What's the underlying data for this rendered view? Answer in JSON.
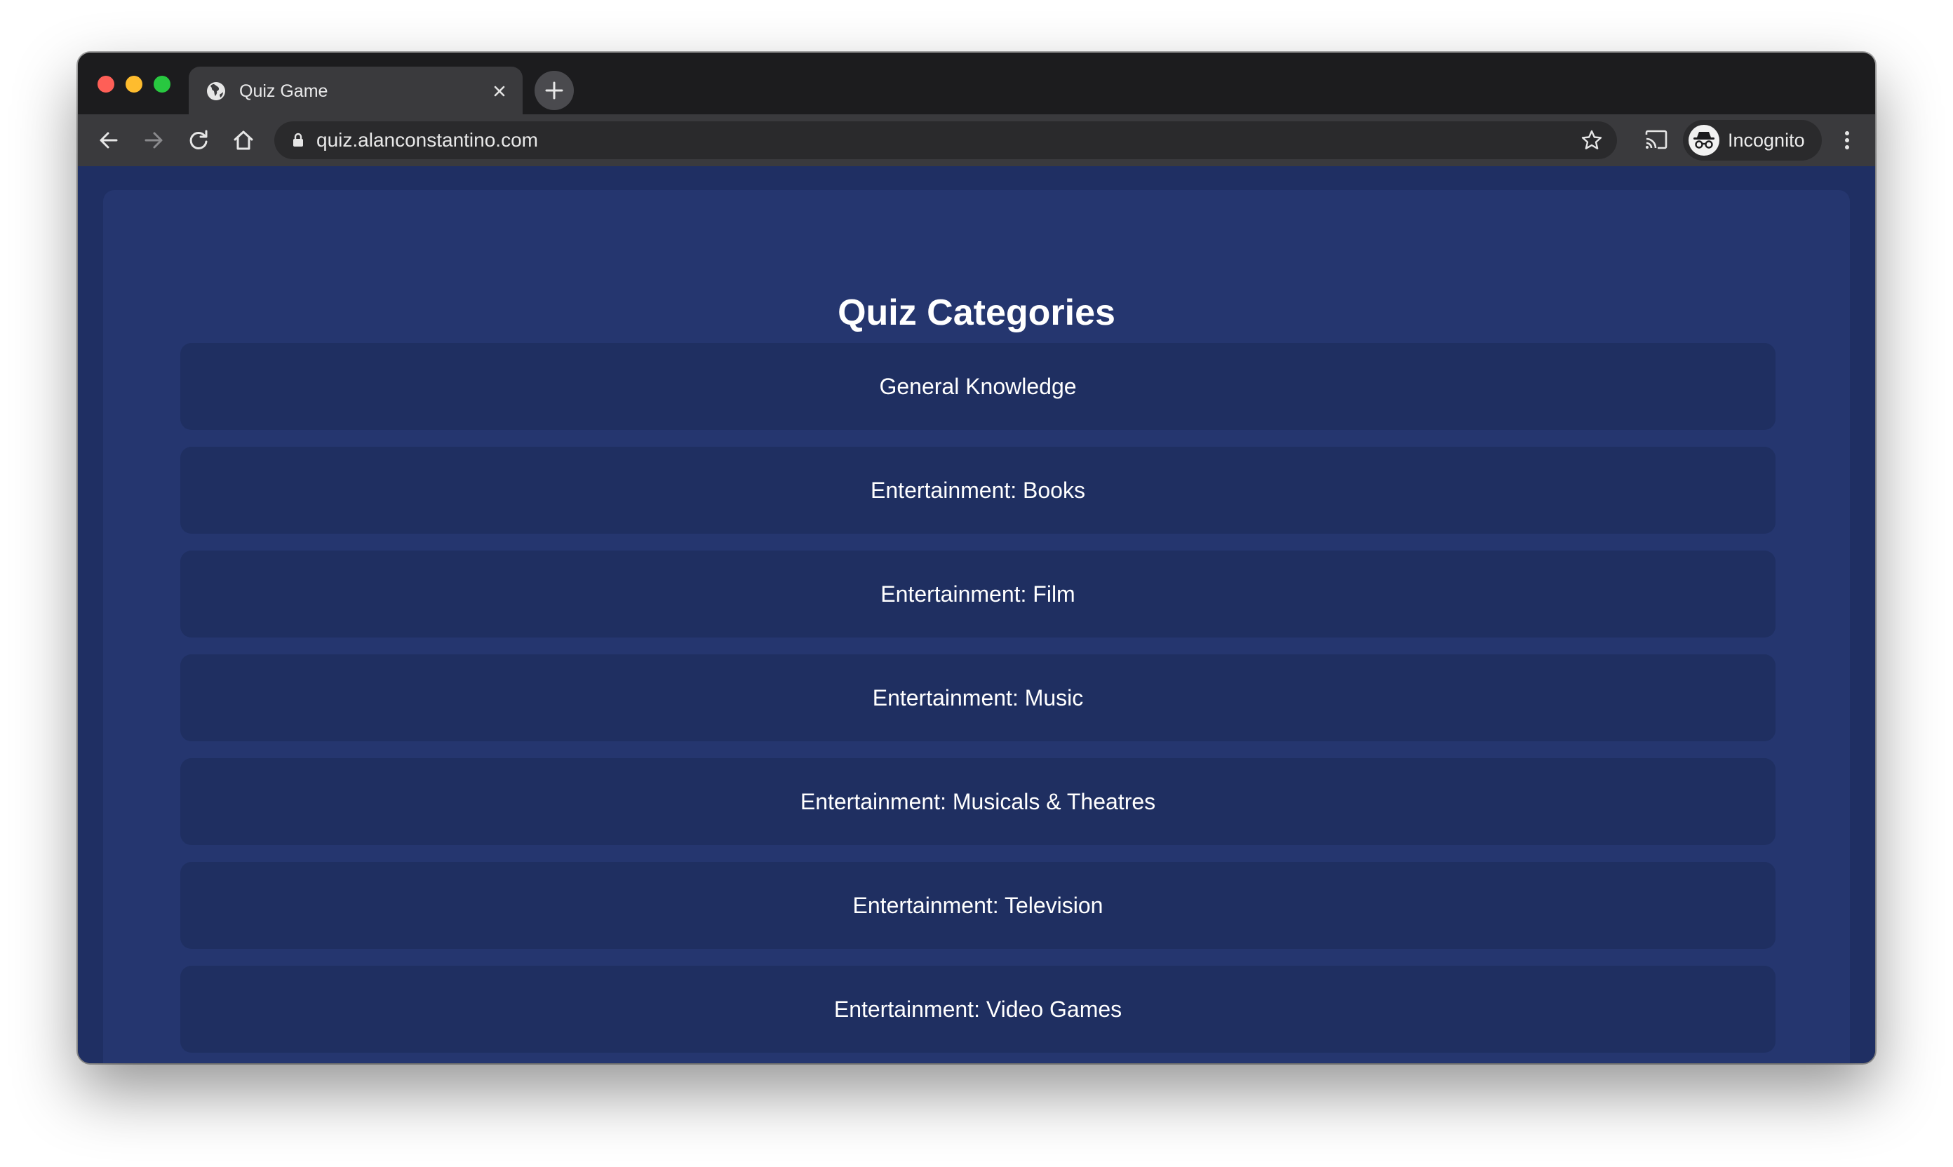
{
  "browser": {
    "tab": {
      "title": "Quiz Game"
    },
    "omnibox": {
      "url": "quiz.alanconstantino.com"
    },
    "profile": {
      "label": "Incognito"
    }
  },
  "main": {
    "title": "Quiz Categories",
    "categories": [
      "General Knowledge",
      "Entertainment: Books",
      "Entertainment: Film",
      "Entertainment: Music",
      "Entertainment: Musicals & Theatres",
      "Entertainment: Television",
      "Entertainment: Video Games"
    ]
  },
  "colors": {
    "page_background": "#1f2f63",
    "card_background": "#25366f",
    "category_background": "#1f2f61",
    "text": "#ffffff"
  },
  "icons": [
    "globe-icon",
    "close-icon",
    "plus-icon",
    "back-arrow-icon",
    "forward-arrow-icon",
    "reload-icon",
    "home-icon",
    "lock-icon",
    "star-icon",
    "cast-icon",
    "incognito-icon",
    "kebab-menu-icon"
  ]
}
